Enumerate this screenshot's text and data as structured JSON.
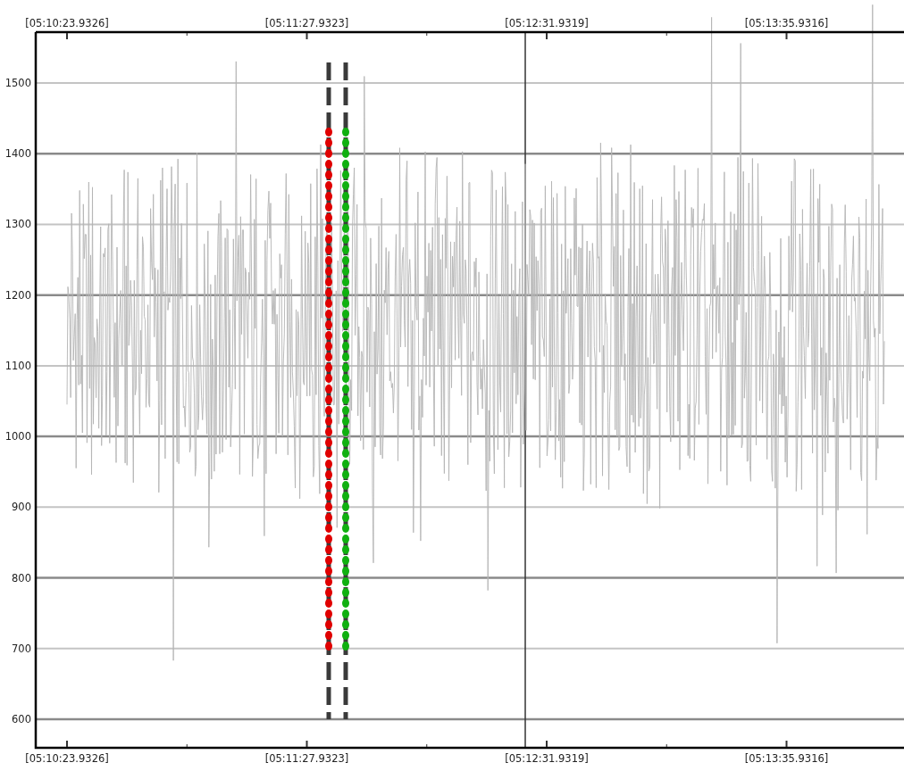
{
  "chart": {
    "time_labels_top": [
      "[05:10:23.9326]",
      "[05:11:27.9323]",
      "[05:12:31.9319]",
      "[05:13:35.9316]"
    ],
    "y_labels": [
      "1500",
      "1400",
      "1300",
      "1200",
      "1100",
      "1000",
      "900",
      "800",
      "700",
      "600"
    ],
    "time_labels_bottom": [
      "[05:10:23.9326]",
      "[05:11:27.9323]",
      "[05:12:31.9319]",
      "[05:13:35.9316]"
    ]
  }
}
